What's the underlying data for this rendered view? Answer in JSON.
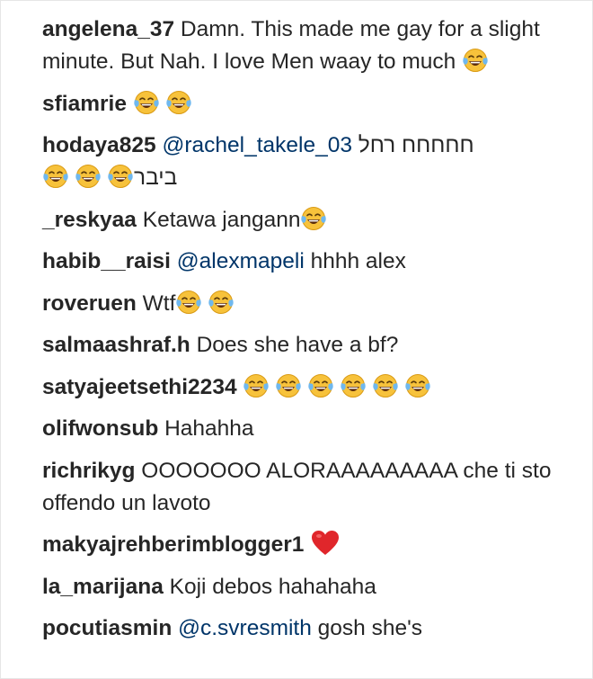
{
  "comments": [
    {
      "user": "angelena_37",
      "text": " Damn. This made me gay for a slight minute. But Nah. I love Men waay to much ",
      "emoji_count": 1
    },
    {
      "user": "sfiamrie",
      "text": " ",
      "emoji_count": 2
    },
    {
      "user": "hodaya825",
      "mention": "@rachel_takele_03",
      "rtl_text": "חחחחח רחל",
      "rtl_text_2": "ביבר",
      "emoji_count": 3
    },
    {
      "user": "_reskyaa",
      "text": " Ketawa jangann",
      "emoji_count": 1
    },
    {
      "user": "habib__raisi",
      "mention": "@alexmapeli",
      "text": " hhhh alex"
    },
    {
      "user": "roveruen",
      "text": " Wtf",
      "emoji_count": 2
    },
    {
      "user": "salmaashraf.h",
      "text": " Does she have a bf?"
    },
    {
      "user": "satyajeetsethi2234",
      "text": " ",
      "emoji_count": 6
    },
    {
      "user": "olifwonsub",
      "text": " Hahahha"
    },
    {
      "user": "richrikyg",
      "text": " OOOOOOO ALORAAAAAAAAA che ti sto offendo un lavoto"
    },
    {
      "user": "makyajrehberimblogger1",
      "heart": true
    },
    {
      "user": "la_marijana",
      "text": " Koji debos hahahaha"
    },
    {
      "user": "pocutiasmin",
      "mention": "@c.svresmith",
      "text": " gosh she's"
    }
  ],
  "icons": {
    "laugh": "face-with-tears-of-joy-icon",
    "heart": "red-heart-icon"
  },
  "colors": {
    "text": "#262626",
    "mention": "#003569",
    "emoji_face": "#f7c23b",
    "emoji_tear": "#6fb8ef",
    "heart": "#e0262b"
  }
}
